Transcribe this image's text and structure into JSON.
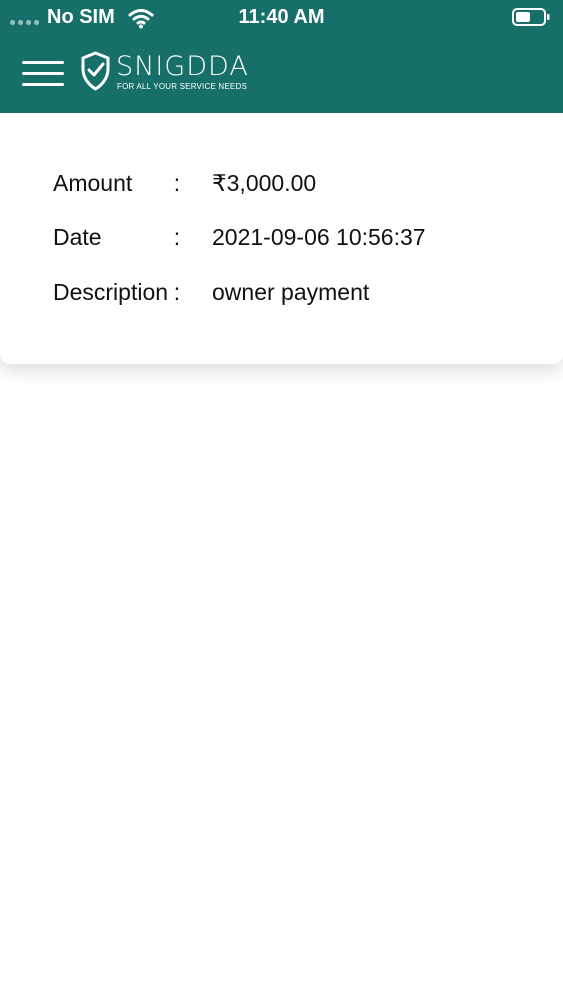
{
  "status_bar": {
    "carrier": "No SIM",
    "time": "11:40 AM",
    "wifi_icon": "wifi-icon",
    "battery_icon": "battery-icon"
  },
  "header": {
    "menu_icon": "hamburger-menu-icon",
    "logo": {
      "name": "SNIGDDA",
      "tagline": "FOR ALL YOUR SERVICE NEEDS",
      "icon": "shield-check-icon"
    },
    "background_color": "#176f6a"
  },
  "transaction": {
    "rows": [
      {
        "label": "Amount",
        "separator": ":",
        "value": "₹3,000.00"
      },
      {
        "label": "Date",
        "separator": ":",
        "value": "2021-09-06 10:56:37"
      },
      {
        "label": "Description",
        "separator": ":",
        "value": "owner payment"
      }
    ]
  }
}
